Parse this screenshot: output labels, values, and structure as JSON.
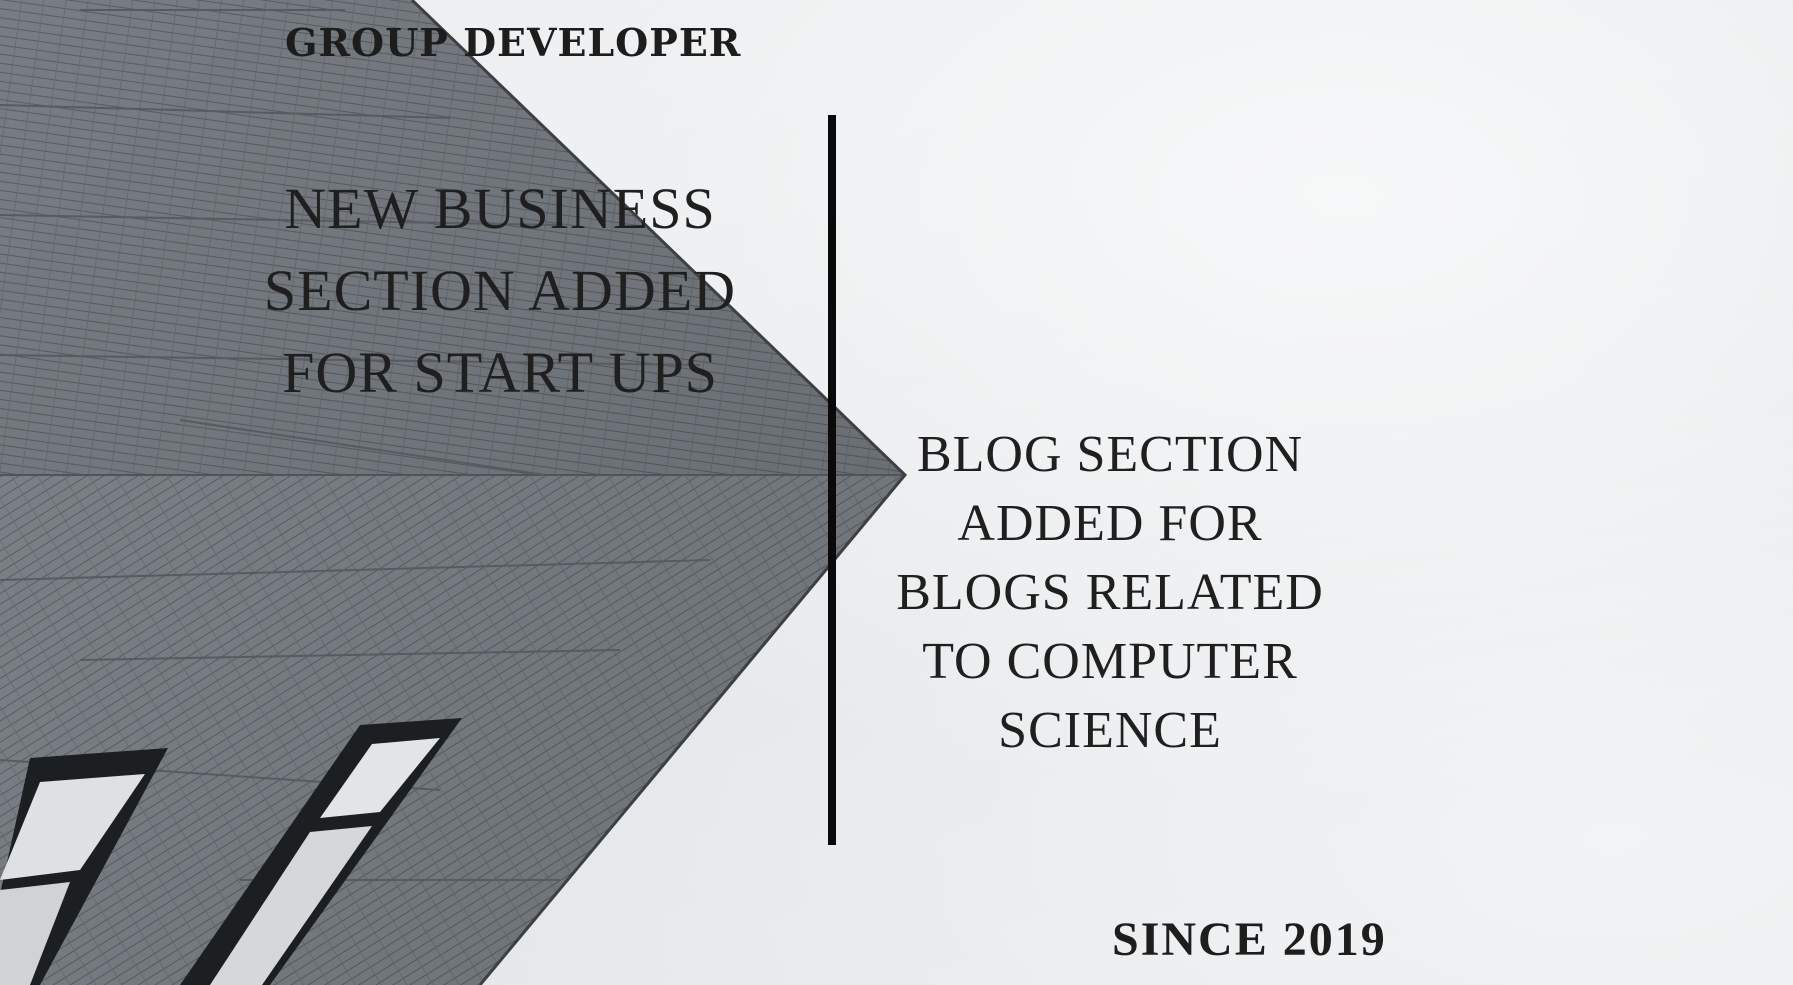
{
  "brand": {
    "title": "GROUP DEVELOPER"
  },
  "headline": {
    "lines": [
      "NEW BUSINESS",
      "SECTION ADDED",
      "FOR START UPS"
    ]
  },
  "blog": {
    "lines": [
      "BLOG SECTION",
      "ADDED FOR",
      "BLOGS RELATED",
      "TO COMPUTER",
      "SCIENCE"
    ]
  },
  "footer": {
    "since": "SINCE 2019"
  },
  "colors": {
    "sky": "#e9ecee",
    "building": "#7d8389",
    "text": "#1d1d1d",
    "divider": "#0a0a0a"
  },
  "images": {
    "background": "modern-building-corner-photo"
  }
}
